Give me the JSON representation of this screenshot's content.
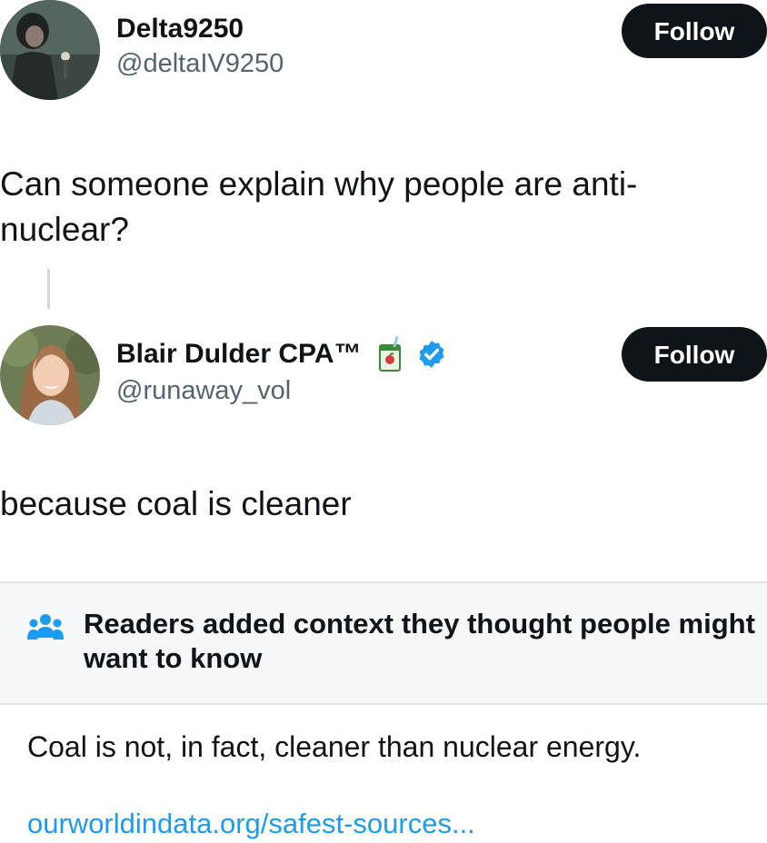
{
  "original_tweet": {
    "display_name": "Delta9250",
    "handle": "@deltaIV9250",
    "follow_label": "Follow",
    "text": "Can someone explain why people are anti-nuclear?"
  },
  "reply_tweet": {
    "display_name": "Blair Dulder CPA™",
    "handle": "@runaway_vol",
    "follow_label": "Follow",
    "name_emoji": "juice-box-icon",
    "verified": true,
    "text": "because coal is cleaner"
  },
  "community_note": {
    "icon": "readers-group-icon",
    "title": "Readers added context they thought people might want to know",
    "body": "Coal is not, in fact, cleaner than nuclear energy.",
    "link_text": "ourworldindata.org/safest-sources..."
  },
  "colors": {
    "text_primary": "#0f1419",
    "text_secondary": "#536471",
    "button_bg": "#0f1419",
    "link": "#1d9bf0",
    "verified": "#1d9bf0",
    "note_header_bg": "#f5f7f8"
  }
}
